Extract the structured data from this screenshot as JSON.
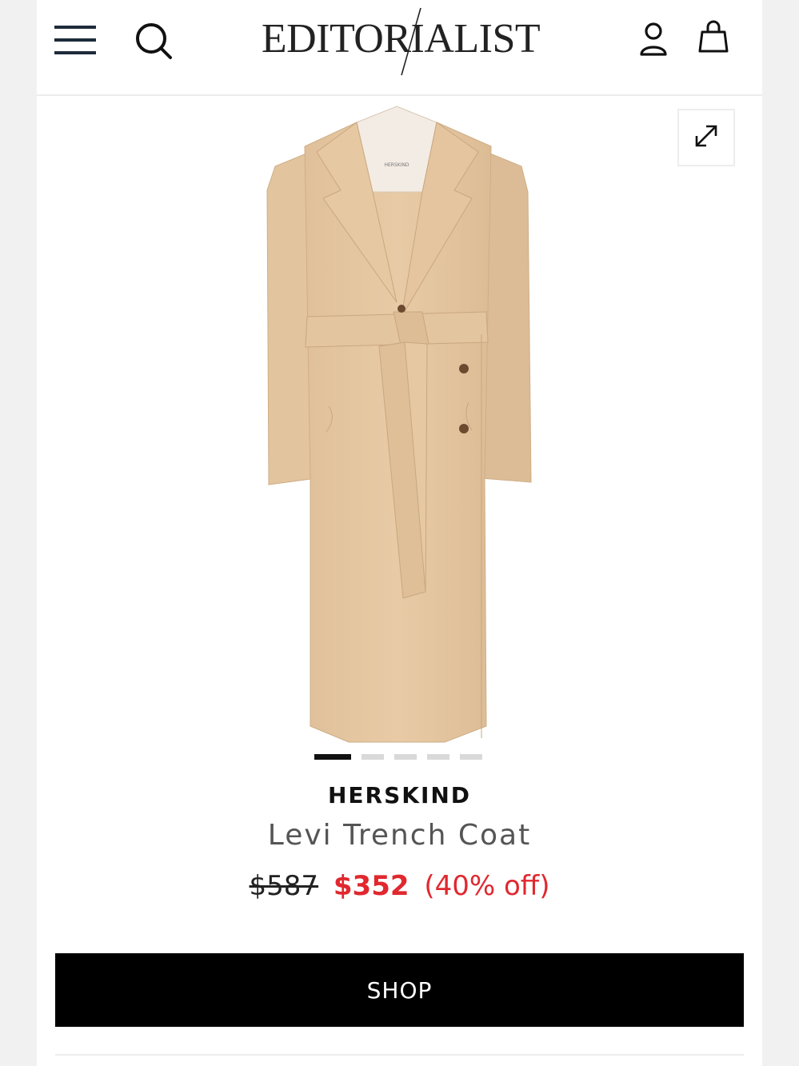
{
  "header": {
    "logo_text": "EDITORIALIST",
    "menu_icon": "hamburger-menu-icon",
    "search_icon": "search-icon",
    "account_icon": "user-account-icon",
    "bag_icon": "shopping-bag-icon"
  },
  "product": {
    "image_label": "HERSKIND",
    "expand_icon": "expand-arrows-icon",
    "gallery": {
      "count": 5,
      "active_index": 0
    },
    "brand": "HERSKIND",
    "name": "Levi Trench Coat",
    "original_price": "$587",
    "sale_price": "$352",
    "discount": "(40% off)"
  },
  "actions": {
    "shop_label": "SHOP"
  },
  "colors": {
    "sale_red": "#e0282e",
    "coat_beige": "#e6c8a3",
    "button_black": "#000000"
  }
}
